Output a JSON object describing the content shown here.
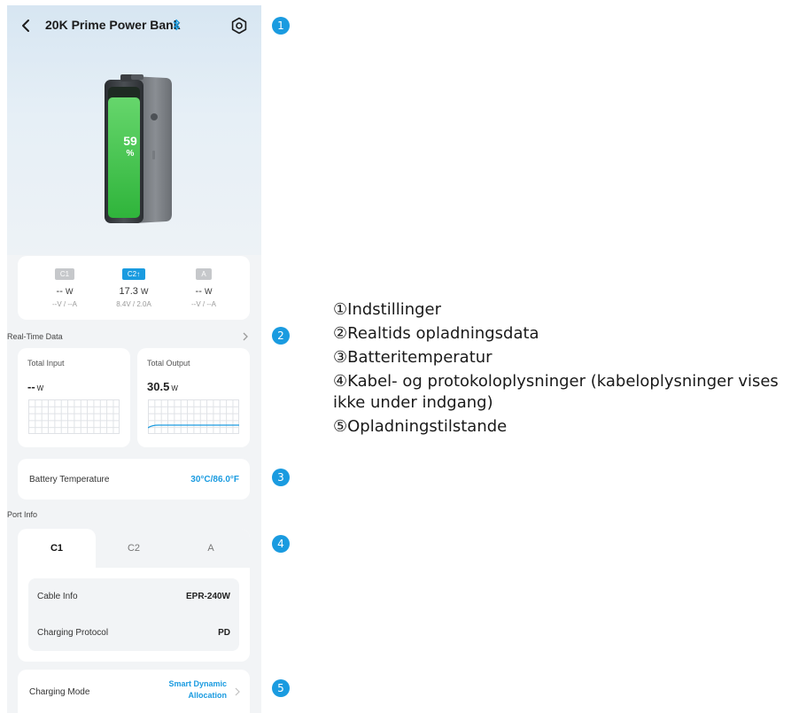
{
  "header": {
    "title": "20K Prime Power Bank",
    "bluetooth_icon": "bluetooth-icon",
    "back_icon": "chevron-left-icon",
    "settings_icon": "gear-icon"
  },
  "battery": {
    "percent": "59",
    "percent_symbol": "%",
    "level_fraction": 0.59
  },
  "ports": [
    {
      "tag": "C1",
      "watts": "-- ",
      "unit": "W",
      "va": "--V / --A",
      "active": false
    },
    {
      "tag": "C2↑",
      "watts": "17.3",
      "unit": "W",
      "va": "8.4V / 2.0A",
      "active": true
    },
    {
      "tag": "A",
      "watts": "-- ",
      "unit": "W",
      "va": "--V / --A",
      "active": false
    }
  ],
  "realtime": {
    "title": "Real-Time Data",
    "input": {
      "label": "Total Input",
      "value": "--",
      "unit": "W"
    },
    "output": {
      "label": "Total Output",
      "value": "30.5",
      "unit": "W"
    }
  },
  "temperature": {
    "label": "Battery Temperature",
    "value": "30°C/86.0°F"
  },
  "port_info": {
    "title": "Port Info",
    "tabs": [
      "C1",
      "C2",
      "A"
    ],
    "active_tab": "C1",
    "cable_label": "Cable Info",
    "cable_value": "EPR-240W",
    "protocol_label": "Charging Protocol",
    "protocol_value": "PD"
  },
  "charging_mode": {
    "label": "Charging Mode",
    "value_line1": "Smart Dynamic",
    "value_line2": "Allocation"
  },
  "badges": [
    "1",
    "2",
    "3",
    "4",
    "5"
  ],
  "legend": [
    "①Indstillinger",
    "②Realtids opladningsdata",
    "③Batteritemperatur",
    "④Kabel- og protokoloplysninger (kabeloplysninger vises ikke under indgang)",
    "⑤Opladningstilstande"
  ],
  "colors": {
    "accent": "#1a9be0",
    "battery_green": "#3fc24a",
    "background": "#f2f4f6"
  }
}
